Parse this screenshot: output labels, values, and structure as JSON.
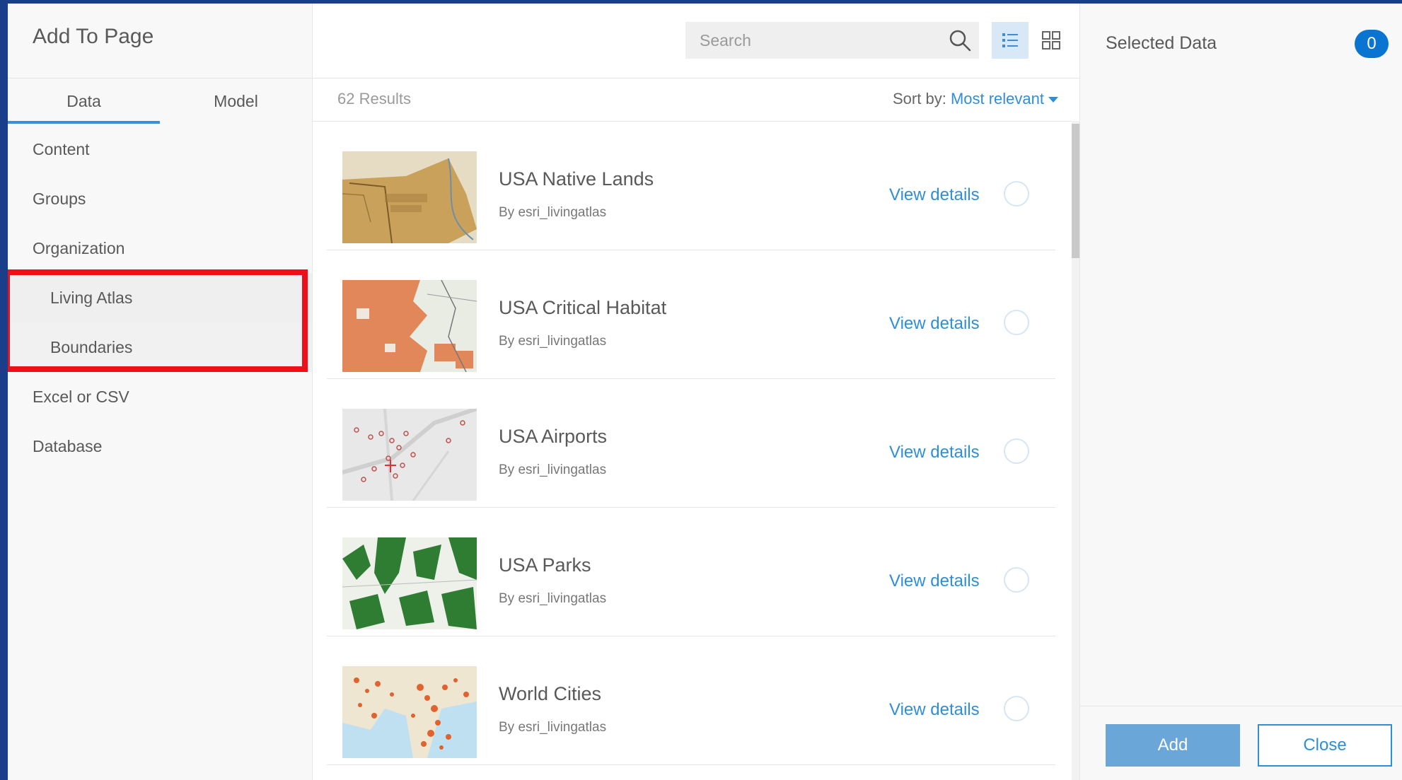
{
  "panel": {
    "title": "Add To Page",
    "tabs": [
      {
        "label": "Data",
        "active": true
      },
      {
        "label": "Model",
        "active": false
      }
    ],
    "nav": [
      {
        "label": "Content"
      },
      {
        "label": "Groups"
      },
      {
        "label": "Organization"
      },
      {
        "label": "Living Atlas"
      },
      {
        "label": "Boundaries"
      },
      {
        "label": "Excel or CSV"
      },
      {
        "label": "Database"
      }
    ]
  },
  "search": {
    "placeholder": "Search",
    "icon": "search-icon"
  },
  "view_toggle": {
    "list_icon": "list-view-icon",
    "grid_icon": "grid-view-icon",
    "active": "list"
  },
  "results": {
    "count_label": "62 Results",
    "sort_prefix": "Sort by:",
    "sort_value": "Most relevant",
    "items": [
      {
        "title": "USA Native Lands",
        "owner": "By esri_livingatlas",
        "link": "View details"
      },
      {
        "title": "USA Critical Habitat",
        "owner": "By esri_livingatlas",
        "link": "View details"
      },
      {
        "title": "USA Airports",
        "owner": "By esri_livingatlas",
        "link": "View details"
      },
      {
        "title": "USA Parks",
        "owner": "By esri_livingatlas",
        "link": "View details"
      },
      {
        "title": "World Cities",
        "owner": "By esri_livingatlas",
        "link": "View details"
      }
    ]
  },
  "selected": {
    "title": "Selected Data",
    "count": "0"
  },
  "footer": {
    "add_label": "Add",
    "close_label": "Close"
  },
  "colors": {
    "accent": "#2f8ed8",
    "badge": "#0a75d1",
    "highlight": "#ef0f1a"
  }
}
